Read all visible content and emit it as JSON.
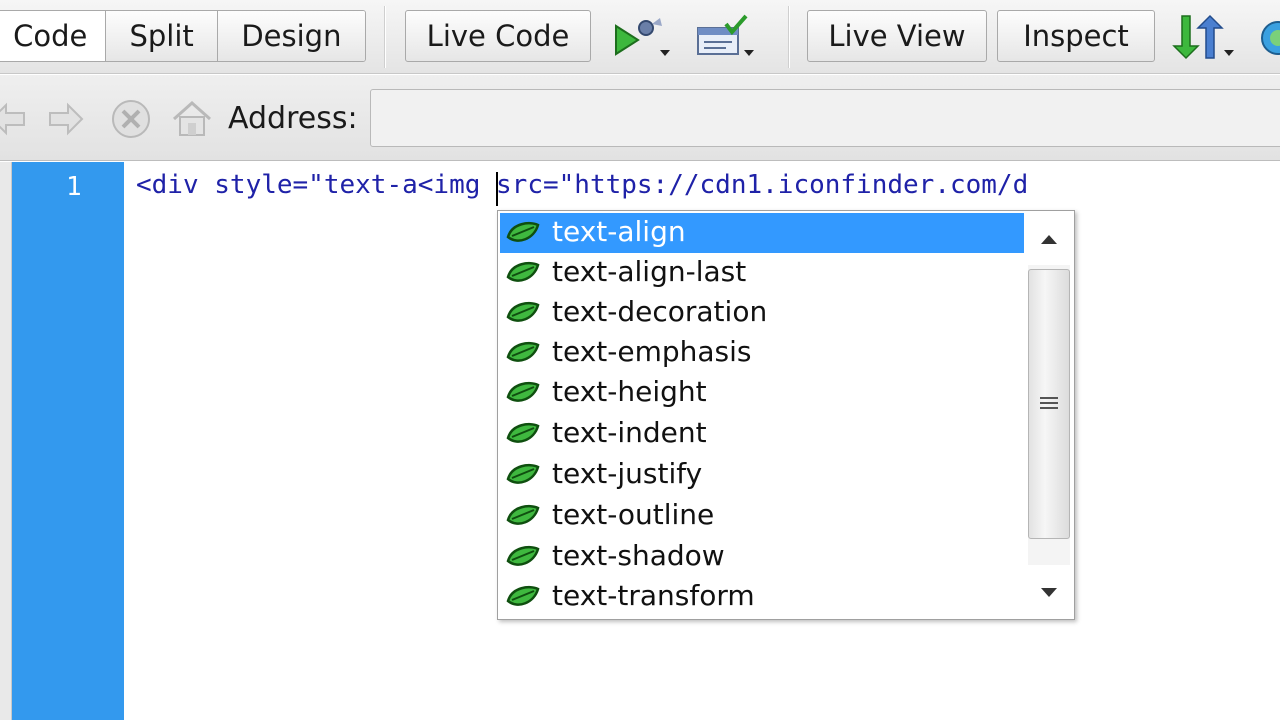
{
  "toolbar": {
    "view_modes": [
      {
        "label": "Code",
        "active": true
      },
      {
        "label": "Split",
        "active": false
      },
      {
        "label": "Design",
        "active": false
      }
    ],
    "live_code_label": "Live Code",
    "live_view_label": "Live View",
    "inspect_label": "Inspect"
  },
  "address_bar": {
    "label": "Address:",
    "value": ""
  },
  "editor": {
    "line_number": "1",
    "code_text": "<div style=\"text-a<img src=\"https://cdn1.iconfinder.com/d"
  },
  "autocomplete": {
    "selected_index": 0,
    "items": [
      "text-align",
      "text-align-last",
      "text-decoration",
      "text-emphasis",
      "text-height",
      "text-indent",
      "text-justify",
      "text-outline",
      "text-shadow",
      "text-transform"
    ]
  },
  "colors": {
    "selection": "#3399ff",
    "gutter": "#3399ee",
    "code_text": "#1f22a8"
  },
  "icons": {
    "preview": "play-in-browser-icon",
    "validate": "validate-markup-icon",
    "file_transfer": "file-transfer-icon",
    "back": "back-arrow-icon",
    "forward": "forward-arrow-icon",
    "stop": "stop-icon",
    "home": "home-icon",
    "css_property": "css-property-leaf-icon"
  }
}
